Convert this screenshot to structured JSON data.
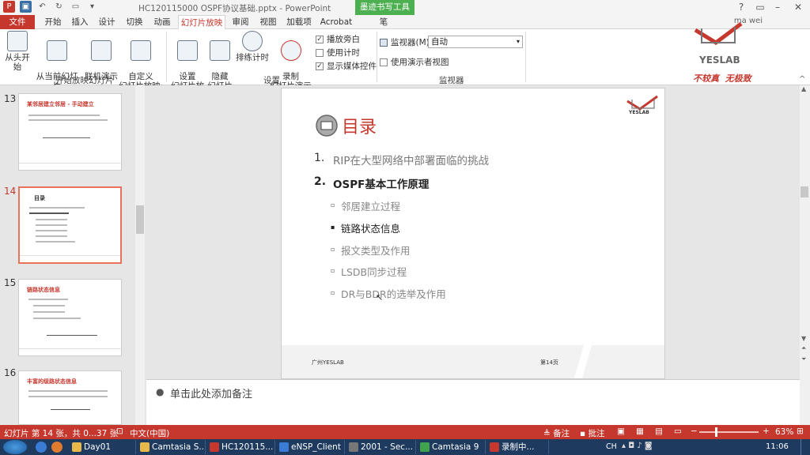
{
  "titlebar": {
    "title": "HC120115000  OSPF协议基础.pptx - PowerPoint",
    "ink_tools": "墨迹书写工具",
    "pen": "笔",
    "help": "?"
  },
  "tabs": [
    {
      "label": "文件"
    },
    {
      "label": "开始"
    },
    {
      "label": "插入"
    },
    {
      "label": "设计"
    },
    {
      "label": "切换"
    },
    {
      "label": "动画"
    },
    {
      "label": "幻灯片放映"
    },
    {
      "label": "审阅"
    },
    {
      "label": "视图"
    },
    {
      "label": "加载项"
    },
    {
      "label": "Acrobat"
    }
  ],
  "user": "ma wei",
  "ribbon": {
    "start_group": {
      "label": "开始放映幻灯片",
      "buttons": [
        "从头开始",
        "从当前幻灯片\n开始",
        "联机演示\n·",
        "自定义\n幻灯片放映·"
      ]
    },
    "setup_group": {
      "label": "设置",
      "buttons": [
        "设置\n幻灯片放映",
        "隐藏\n幻灯片",
        "排练计时",
        "录制\n幻灯片演示·"
      ],
      "checks": [
        {
          "label": "播放旁白",
          "checked": true
        },
        {
          "label": "使用计时",
          "checked": false
        },
        {
          "label": "显示媒体控件",
          "checked": true
        }
      ]
    },
    "monitor_group": {
      "label": "监视器",
      "monitor_label": "监视器(M):",
      "monitor_value": "自动",
      "presenter": "使用演示者视图"
    }
  },
  "logo": {
    "brand": "YESLAB",
    "slogan": "不较真  无极致"
  },
  "thumbnails": [
    {
      "num": "13",
      "title": "某邻居建立邻居 - 手动建立"
    },
    {
      "num": "14",
      "title": "目录"
    },
    {
      "num": "15",
      "title": "链路状态信息"
    },
    {
      "num": "16",
      "title": "丰富的级路状态信息"
    }
  ],
  "slide": {
    "title": "目录",
    "logo": "YESLAB",
    "items": [
      {
        "num": "1.",
        "text": "RIP在大型网络中部署面临的挑战"
      },
      {
        "num": "2.",
        "text": "OSPF基本工作原理"
      }
    ],
    "subitems": [
      {
        "text": "邻居建立过程",
        "active": false
      },
      {
        "text": "链路状态信息",
        "active": true
      },
      {
        "text": "报文类型及作用",
        "active": false
      },
      {
        "text": "LSDB同步过程",
        "active": false
      },
      {
        "text": "DR与BDR的选举及作用",
        "active": false
      }
    ],
    "footer_left": "广州YESLAB",
    "footer_right": "第14页"
  },
  "notes": {
    "placeholder": "单击此处添加备注"
  },
  "status": {
    "slide_info": "幻灯片 第 14 张，共 0...37 张",
    "language": "中文(中国)",
    "notes": "备注",
    "comments": "批注",
    "zoom": "63%"
  },
  "taskbar": {
    "tasks": [
      {
        "label": "Day01",
        "color": "#e8b84a"
      },
      {
        "label": "Camtasia S...",
        "color": "#e8b84a"
      },
      {
        "label": "HC120115...",
        "color": "#c6382e"
      },
      {
        "label": "eNSP_Client",
        "color": "#3a7bd5"
      },
      {
        "label": "2001 - Sec...",
        "color": "#777"
      },
      {
        "label": "Camtasia 9",
        "color": "#3fa34d"
      },
      {
        "label": "录制中...",
        "color": "#c6382e"
      }
    ],
    "ime": "CH",
    "time": "11:06"
  }
}
